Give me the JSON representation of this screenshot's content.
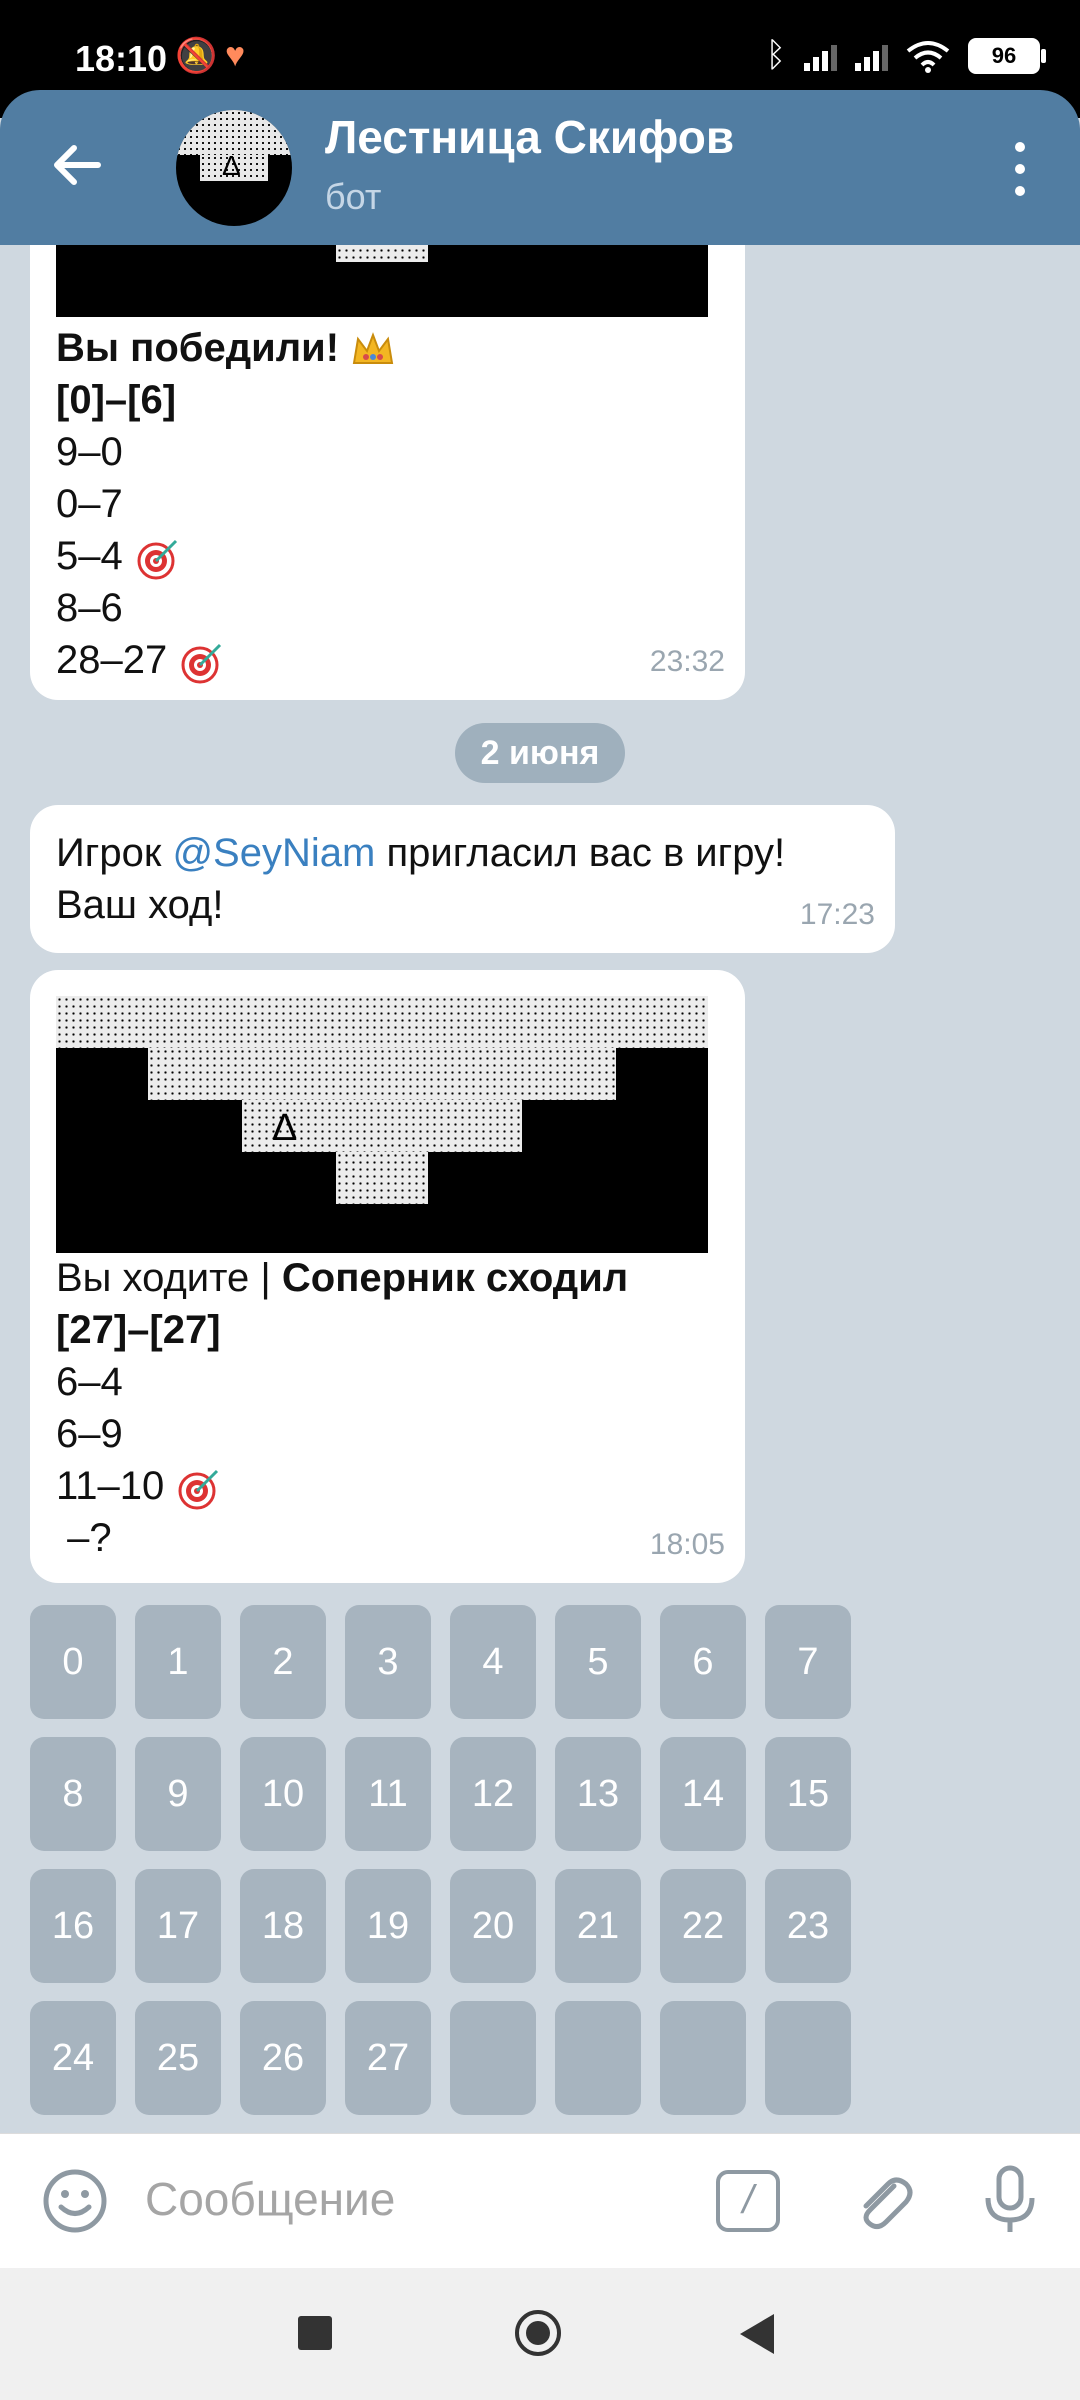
{
  "status_bar": {
    "time": "18:10",
    "battery": "96"
  },
  "header": {
    "title": "Лестница Скифов",
    "subtitle": "бот"
  },
  "messages": {
    "m1": {
      "title": "Вы победили!",
      "score": "[0]–[6]",
      "lines": [
        "9–0",
        "0–7",
        "5–4",
        "8–6",
        "28–27"
      ],
      "time": "23:32"
    },
    "date_divider": "2 июня",
    "m2": {
      "prefix": "Игрок ",
      "mention": "@SeyNiam",
      "suffix": " пригласил вас в игру!",
      "line2": "Ваш ход!",
      "time": "17:23"
    },
    "m3": {
      "status_left": "Вы ходите | ",
      "status_right": "Соперник сходил",
      "score": "[27]–[27]",
      "lines": [
        "6–4",
        "6–9",
        "11–10",
        " –?"
      ],
      "time": "18:05",
      "marker": "Δ"
    }
  },
  "keyboard": [
    "0",
    "1",
    "2",
    "3",
    "4",
    "5",
    "6",
    "7",
    "8",
    "9",
    "10",
    "11",
    "12",
    "13",
    "14",
    "15",
    "16",
    "17",
    "18",
    "19",
    "20",
    "21",
    "22",
    "23",
    "24",
    "25",
    "26",
    "27",
    "",
    "",
    "",
    ""
  ],
  "input": {
    "placeholder": "Сообщение",
    "command_glyph": "/"
  },
  "avatar": {
    "marker": "Δ"
  },
  "colors": {
    "header": "#517da2",
    "key": "#a7b4bf",
    "link": "#3a80c0"
  }
}
